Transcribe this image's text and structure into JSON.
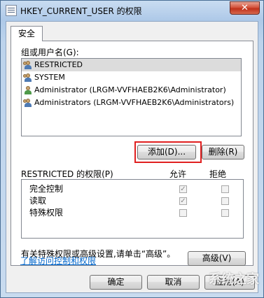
{
  "window": {
    "title": "HKEY_CURRENT_USER 的权限",
    "close_label": "✕"
  },
  "tabs": [
    {
      "label": "安全"
    }
  ],
  "groups": {
    "label": "组或用户名(G):",
    "items": [
      {
        "name": "RESTRICTED",
        "icon": "user-group-icon"
      },
      {
        "name": "SYSTEM",
        "icon": "user-group-icon"
      },
      {
        "name": "Administrator (LRGM-VVFHAEB2K6\\Administrator)",
        "icon": "user-icon"
      },
      {
        "name": "Administrators (LRGM-VVFHAEB2K6\\Administrators)",
        "icon": "user-group-icon"
      }
    ]
  },
  "buttons": {
    "add": "添加(D)...",
    "remove": "删除(R)",
    "advanced": "高级(V)",
    "ok": "确定",
    "cancel": "取消",
    "apply": "应用(A)"
  },
  "permissions": {
    "title": "RESTRICTED 的权限(P)",
    "allow_label": "允许",
    "deny_label": "拒绝",
    "rows": [
      {
        "name": "完全控制",
        "allow": true,
        "deny": false
      },
      {
        "name": "读取",
        "allow": true,
        "deny": false
      },
      {
        "name": "特殊权限",
        "allow": false,
        "deny": false
      }
    ]
  },
  "advanced_text": "有关特殊权限或高级设置,请单击“高级”。",
  "learn_link": "了解访问控制和权限",
  "watermark": "系统之家"
}
